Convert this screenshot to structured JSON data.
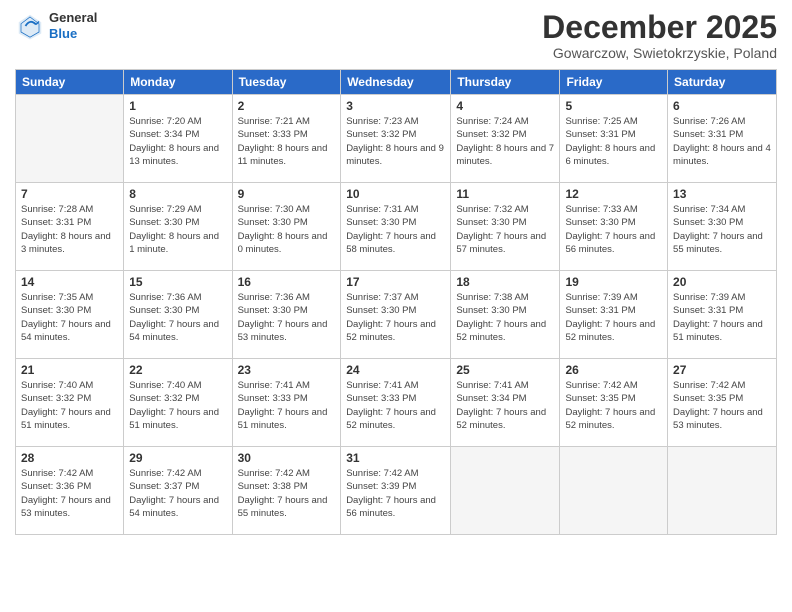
{
  "logo": {
    "general": "General",
    "blue": "Blue"
  },
  "title": "December 2025",
  "location": "Gowarczow, Swietokrzyskie, Poland",
  "header_days": [
    "Sunday",
    "Monday",
    "Tuesday",
    "Wednesday",
    "Thursday",
    "Friday",
    "Saturday"
  ],
  "weeks": [
    [
      {
        "day": "",
        "info": ""
      },
      {
        "day": "1",
        "info": "Sunrise: 7:20 AM\nSunset: 3:34 PM\nDaylight: 8 hours\nand 13 minutes."
      },
      {
        "day": "2",
        "info": "Sunrise: 7:21 AM\nSunset: 3:33 PM\nDaylight: 8 hours\nand 11 minutes."
      },
      {
        "day": "3",
        "info": "Sunrise: 7:23 AM\nSunset: 3:32 PM\nDaylight: 8 hours\nand 9 minutes."
      },
      {
        "day": "4",
        "info": "Sunrise: 7:24 AM\nSunset: 3:32 PM\nDaylight: 8 hours\nand 7 minutes."
      },
      {
        "day": "5",
        "info": "Sunrise: 7:25 AM\nSunset: 3:31 PM\nDaylight: 8 hours\nand 6 minutes."
      },
      {
        "day": "6",
        "info": "Sunrise: 7:26 AM\nSunset: 3:31 PM\nDaylight: 8 hours\nand 4 minutes."
      }
    ],
    [
      {
        "day": "7",
        "info": "Sunrise: 7:28 AM\nSunset: 3:31 PM\nDaylight: 8 hours\nand 3 minutes."
      },
      {
        "day": "8",
        "info": "Sunrise: 7:29 AM\nSunset: 3:30 PM\nDaylight: 8 hours\nand 1 minute."
      },
      {
        "day": "9",
        "info": "Sunrise: 7:30 AM\nSunset: 3:30 PM\nDaylight: 8 hours\nand 0 minutes."
      },
      {
        "day": "10",
        "info": "Sunrise: 7:31 AM\nSunset: 3:30 PM\nDaylight: 7 hours\nand 58 minutes."
      },
      {
        "day": "11",
        "info": "Sunrise: 7:32 AM\nSunset: 3:30 PM\nDaylight: 7 hours\nand 57 minutes."
      },
      {
        "day": "12",
        "info": "Sunrise: 7:33 AM\nSunset: 3:30 PM\nDaylight: 7 hours\nand 56 minutes."
      },
      {
        "day": "13",
        "info": "Sunrise: 7:34 AM\nSunset: 3:30 PM\nDaylight: 7 hours\nand 55 minutes."
      }
    ],
    [
      {
        "day": "14",
        "info": "Sunrise: 7:35 AM\nSunset: 3:30 PM\nDaylight: 7 hours\nand 54 minutes."
      },
      {
        "day": "15",
        "info": "Sunrise: 7:36 AM\nSunset: 3:30 PM\nDaylight: 7 hours\nand 54 minutes."
      },
      {
        "day": "16",
        "info": "Sunrise: 7:36 AM\nSunset: 3:30 PM\nDaylight: 7 hours\nand 53 minutes."
      },
      {
        "day": "17",
        "info": "Sunrise: 7:37 AM\nSunset: 3:30 PM\nDaylight: 7 hours\nand 52 minutes."
      },
      {
        "day": "18",
        "info": "Sunrise: 7:38 AM\nSunset: 3:30 PM\nDaylight: 7 hours\nand 52 minutes."
      },
      {
        "day": "19",
        "info": "Sunrise: 7:39 AM\nSunset: 3:31 PM\nDaylight: 7 hours\nand 52 minutes."
      },
      {
        "day": "20",
        "info": "Sunrise: 7:39 AM\nSunset: 3:31 PM\nDaylight: 7 hours\nand 51 minutes."
      }
    ],
    [
      {
        "day": "21",
        "info": "Sunrise: 7:40 AM\nSunset: 3:32 PM\nDaylight: 7 hours\nand 51 minutes."
      },
      {
        "day": "22",
        "info": "Sunrise: 7:40 AM\nSunset: 3:32 PM\nDaylight: 7 hours\nand 51 minutes."
      },
      {
        "day": "23",
        "info": "Sunrise: 7:41 AM\nSunset: 3:33 PM\nDaylight: 7 hours\nand 51 minutes."
      },
      {
        "day": "24",
        "info": "Sunrise: 7:41 AM\nSunset: 3:33 PM\nDaylight: 7 hours\nand 52 minutes."
      },
      {
        "day": "25",
        "info": "Sunrise: 7:41 AM\nSunset: 3:34 PM\nDaylight: 7 hours\nand 52 minutes."
      },
      {
        "day": "26",
        "info": "Sunrise: 7:42 AM\nSunset: 3:35 PM\nDaylight: 7 hours\nand 52 minutes."
      },
      {
        "day": "27",
        "info": "Sunrise: 7:42 AM\nSunset: 3:35 PM\nDaylight: 7 hours\nand 53 minutes."
      }
    ],
    [
      {
        "day": "28",
        "info": "Sunrise: 7:42 AM\nSunset: 3:36 PM\nDaylight: 7 hours\nand 53 minutes."
      },
      {
        "day": "29",
        "info": "Sunrise: 7:42 AM\nSunset: 3:37 PM\nDaylight: 7 hours\nand 54 minutes."
      },
      {
        "day": "30",
        "info": "Sunrise: 7:42 AM\nSunset: 3:38 PM\nDaylight: 7 hours\nand 55 minutes."
      },
      {
        "day": "31",
        "info": "Sunrise: 7:42 AM\nSunset: 3:39 PM\nDaylight: 7 hours\nand 56 minutes."
      },
      {
        "day": "",
        "info": ""
      },
      {
        "day": "",
        "info": ""
      },
      {
        "day": "",
        "info": ""
      }
    ]
  ]
}
